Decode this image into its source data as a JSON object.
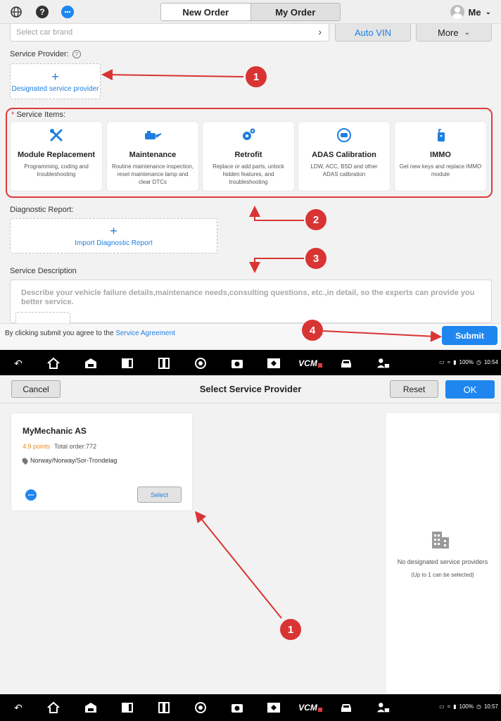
{
  "topbar": {
    "tabs": [
      {
        "label": "New Order",
        "active": true
      },
      {
        "label": "My Order",
        "active": false
      }
    ],
    "user_label": "Me",
    "icons": [
      "globe-icon",
      "help-icon",
      "chat-icon"
    ]
  },
  "form": {
    "brand_placeholder": "Select car brand",
    "auto_vin_label": "Auto VIN",
    "more_label": "More",
    "service_provider_label": "Service Provider:",
    "designated_provider_label": "Designated service provider",
    "required_mark": "*",
    "service_items_label": "Service Items:",
    "service_items": [
      {
        "title": "Module Replacement",
        "desc": "Programming, coding and troubleshooting",
        "icon": "tools-icon"
      },
      {
        "title": "Maintenance",
        "desc": "Routine maintenance inspection, reset maintenance lamp and clear DTCs",
        "icon": "oil-can-icon"
      },
      {
        "title": "Retrofit",
        "desc": "Replace or add parts, unlock hidden features, and troubleshooting",
        "icon": "gears-icon"
      },
      {
        "title": "ADAS Calibration",
        "desc": "LDW, ACC, BSD and other ADAS calibration",
        "icon": "adas-icon"
      },
      {
        "title": "IMMO",
        "desc": "Get new keys and replace IMMO module",
        "icon": "key-fob-icon"
      }
    ],
    "diagnostic_report_label": "Diagnostic Report:",
    "import_report_label": "Import Diagnostic Report",
    "service_description_label": "Service Description",
    "description_placeholder": "Describe your vehicle failure details,maintenance needs,consulting questions, etc.,in detail, so the experts can provide you better service.",
    "agreement_prefix": "By clicking submit you agree to the",
    "agreement_link": "Service Agreement",
    "submit_label": "Submit"
  },
  "sysbar1": {
    "battery": "100%",
    "time": "10:54"
  },
  "select_provider": {
    "cancel_label": "Cancel",
    "title": "Select Service Provider",
    "reset_label": "Reset",
    "ok_label": "OK",
    "provider": {
      "name": "MyMechanic AS",
      "points": "4.9 points",
      "total_order": "Total order:772",
      "location": "Norway/Norway/Sor-Trondelag",
      "select_label": "Select"
    },
    "empty_text": "No designated service providers",
    "empty_hint": "(Up to 1 can be selected)"
  },
  "sysbar2": {
    "battery": "100%",
    "time": "10:57"
  },
  "sys_icons": [
    "back-icon",
    "home-icon",
    "garage-icon",
    "window-icon",
    "split-icon",
    "chrome-icon",
    "camera-icon",
    "screen-icon",
    "vcm-icon",
    "car-icon",
    "mechanic-icon"
  ],
  "sys_vcm_label": "VCM",
  "annotations": [
    "1",
    "2",
    "3",
    "4",
    "1"
  ],
  "colors": {
    "accent": "#1f86f0",
    "annotation": "#d93434",
    "points": "#f08c1e"
  }
}
